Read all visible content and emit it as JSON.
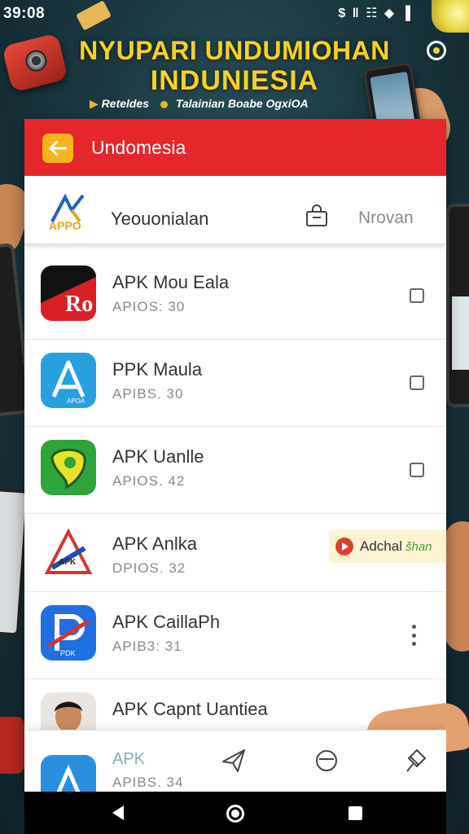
{
  "status_bar": {
    "time": "39:08",
    "icons": "$ ǁ ☷ ◆ ▐"
  },
  "banner": {
    "line1": "NYUPARI UNDUMIOHAN",
    "line2": "INDUNIESIA",
    "sub_left": "Reteldes",
    "sub_right": "Talainian Boabe OgxiOA"
  },
  "header": {
    "title": "Undomesia"
  },
  "sub_header": {
    "logo_text": "APPO",
    "title": "Yeouonialan",
    "link": "Nrovan"
  },
  "apps": [
    {
      "name": "APK Mou Eala",
      "meta": "APIOS:  30",
      "control": "checkbox",
      "icon_text": "Ro"
    },
    {
      "name": "PPK Maula",
      "meta": "APIBS.  30",
      "control": "checkbox",
      "icon_text": "APOA"
    },
    {
      "name": "APK Uanlle",
      "meta": "APIOS.  42",
      "control": "checkbox",
      "icon_text": ""
    },
    {
      "name": "APK Anlka",
      "meta": "DPIOS.  32",
      "control": "chip",
      "icon_text": "APK"
    },
    {
      "name": "APK CaillaPh",
      "meta": "APIB3:  31",
      "control": "kebab",
      "icon_text": "PDK"
    },
    {
      "name": "APK Capnt Uantiea",
      "meta": "",
      "control": "none",
      "icon_text": ""
    }
  ],
  "action_chip": {
    "label": "Adchal",
    "label2": "šhan"
  },
  "bottom_nav": {
    "label": "APK",
    "meta": "APIBS.  34",
    "icons": [
      "send-icon",
      "minus-circle-icon",
      "pin-icon"
    ]
  },
  "colors": {
    "header": "#e5262b",
    "back_button": "#f3b41d",
    "banner_text": "#f3d22a"
  }
}
